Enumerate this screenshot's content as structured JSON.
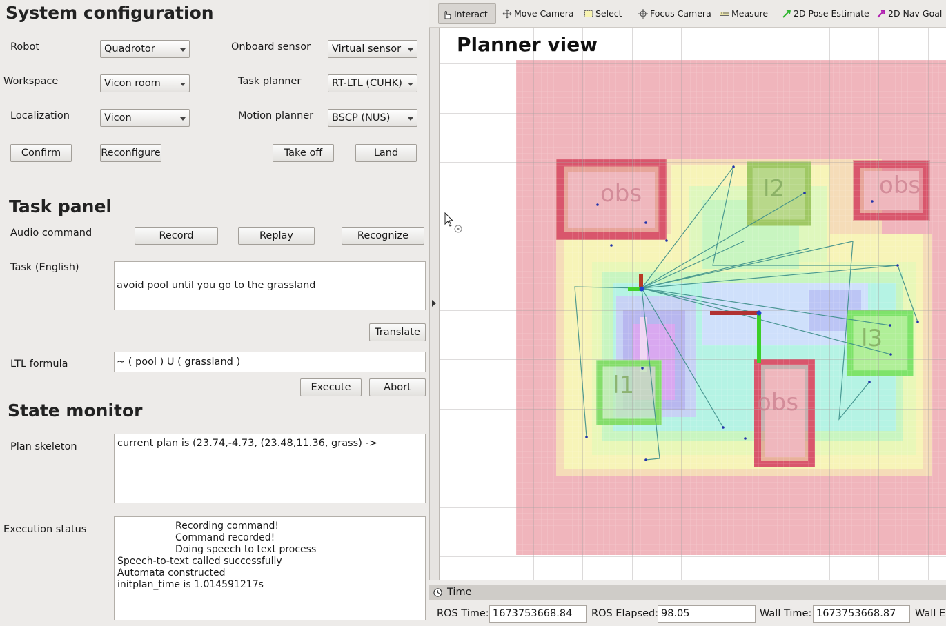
{
  "system_config": {
    "title": "System configuration",
    "robot_label": "Robot",
    "robot_value": "Quadrotor",
    "sensor_label": "Onboard sensor",
    "sensor_value": "Virtual sensor",
    "workspace_label": "Workspace",
    "workspace_value": "Vicon room",
    "task_planner_label": "Task planner",
    "task_planner_value": "RT-LTL (CUHK)",
    "localization_label": "Localization",
    "localization_value": "Vicon",
    "motion_planner_label": "Motion planner",
    "motion_planner_value": "BSCP (NUS)",
    "confirm": "Confirm",
    "reconfigure": "Reconfigure",
    "take_off": "Take off",
    "land": "Land"
  },
  "task_panel": {
    "title": "Task panel",
    "audio_label": "Audio command",
    "record": "Record",
    "replay": "Replay",
    "recognize": "Recognize",
    "task_label": "Task (English)",
    "task_text": "avoid pool until you go to the grassland",
    "translate": "Translate",
    "ltl_label": "LTL formula",
    "ltl_value": "~ ( pool ) U ( grassland )",
    "execute": "Execute",
    "abort": "Abort"
  },
  "state_monitor": {
    "title": "State monitor",
    "plan_label": "Plan skeleton",
    "plan_text": "current plan is (23.74,-4.73, (23.48,11.36, grass) ->",
    "exec_label": "Execution status",
    "exec_lines": [
      "Recording command!",
      "Command recorded!",
      "Doing speech to text process",
      "Speech-to-text called successfully",
      "Automata constructed",
      "initplan_time is 1.014591217s"
    ]
  },
  "toolbar": {
    "interact": "Interact",
    "move_camera": "Move Camera",
    "select": "Select",
    "focus_camera": "Focus Camera",
    "measure": "Measure",
    "pose_estimate": "2D Pose Estimate",
    "nav_goal": "2D Nav Goal"
  },
  "viewport": {
    "title": "Planner view",
    "labels": {
      "obs_1": "obs",
      "obs_2": "obs",
      "obs_3": "obs",
      "l1": "l1",
      "l2": "l2",
      "l3": "l3"
    }
  },
  "time_panel": {
    "title": "Time",
    "ros_time_label": "ROS Time:",
    "ros_time_value": "1673753668.84",
    "ros_elapsed_label": "ROS Elapsed:",
    "ros_elapsed_value": "98.05",
    "wall_time_label": "Wall Time:",
    "wall_time_value": "1673753668.87",
    "wall_elapsed_label": "Wall El"
  },
  "colors": {
    "obstacle": "#d9707f",
    "region": "#88e06a",
    "grid_line": "#b0a8a6",
    "inflation": "#f2b6bc"
  }
}
